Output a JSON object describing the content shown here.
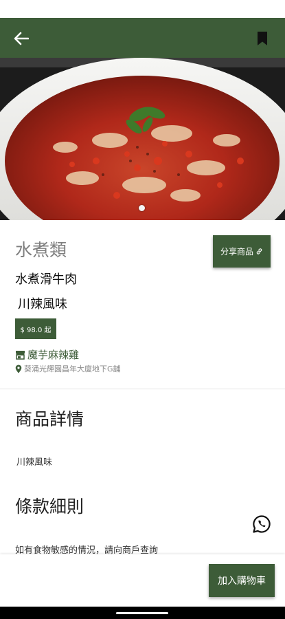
{
  "app_bar": {
    "background_color": "#3d5c38",
    "back_icon": "arrow-left-icon",
    "bookmark_icon": "bookmark-icon"
  },
  "hero": {
    "image_alt": "水煮滑牛肉",
    "carousel_page": 1,
    "carousel_total": 1
  },
  "product": {
    "category": "水煮類",
    "name": "水煮滑牛肉",
    "flavor": "川辣風味",
    "price": "$ 98.0 起",
    "share_label": "分享商品",
    "share_icon": "link-icon"
  },
  "store": {
    "icon": "store-icon",
    "name": "魔芋麻辣雞",
    "location_icon": "location-pin-icon",
    "address": "葵涌光輝園昌年大廈地下G舖"
  },
  "details": {
    "title": "商品詳情",
    "text": "川辣風味"
  },
  "terms": {
    "title": "條款細則",
    "text": "如有食物敏感的情況，請向商戶查詢"
  },
  "whatsapp": {
    "icon": "whatsapp-icon"
  },
  "bottom_bar": {
    "cart_label": "加入購物車"
  },
  "colors": {
    "accent": "#3d5c38",
    "category_text": "#7f7f7f",
    "address_text": "#8a8a8a"
  }
}
